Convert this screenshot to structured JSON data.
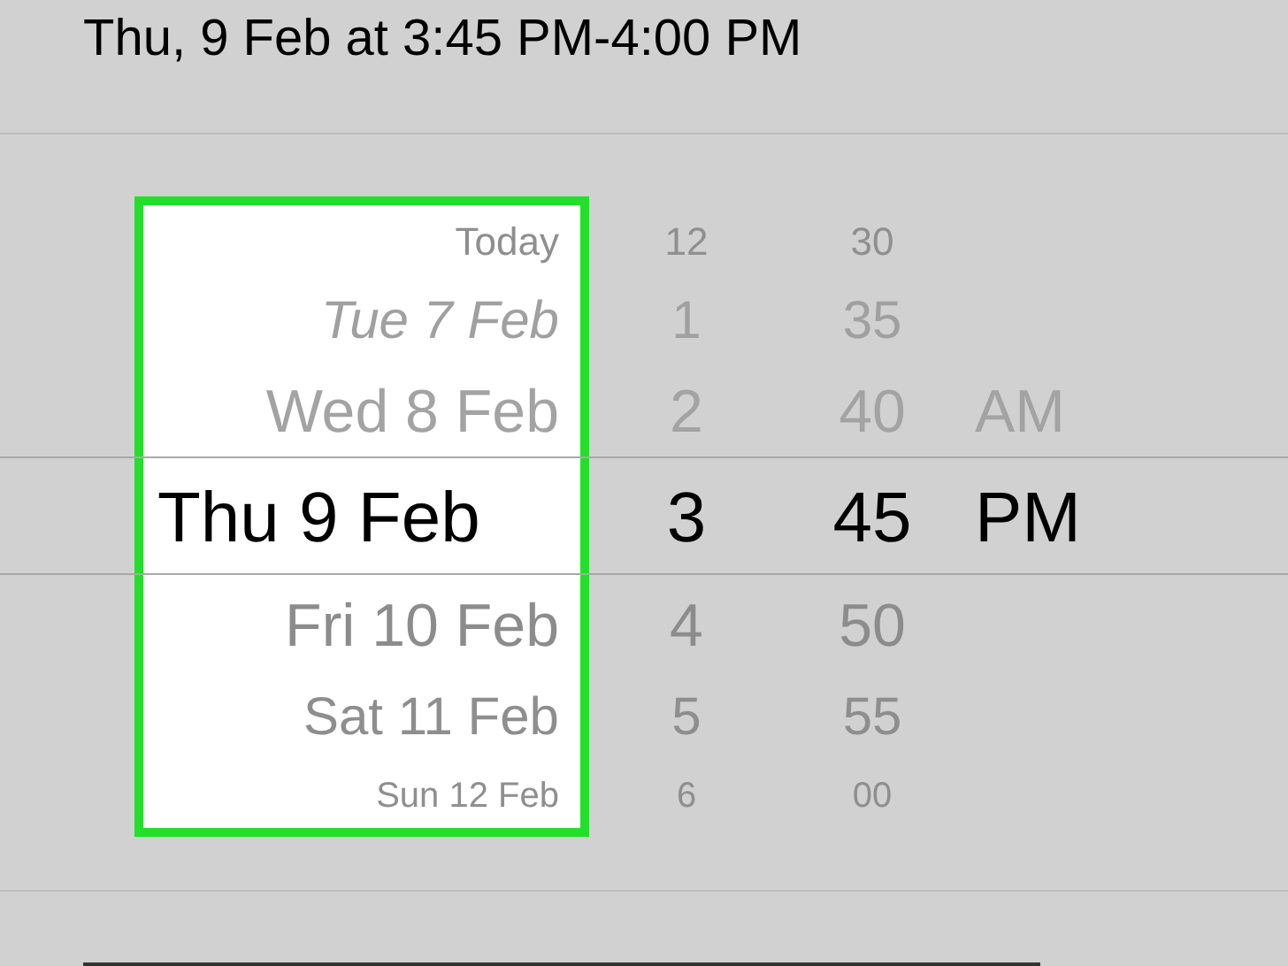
{
  "header": {
    "title": "Thu, 9 Feb at 3:45 PM-4:00 PM"
  },
  "picker": {
    "columns": [
      {
        "kind": "date",
        "highlighted": true,
        "items": [
          {
            "label": "Today",
            "selected": false
          },
          {
            "label": "Tue 7 Feb",
            "selected": false
          },
          {
            "label": "Wed 8 Feb",
            "selected": false
          },
          {
            "label": "Thu 9 Feb",
            "selected": true
          },
          {
            "label": "Fri 10 Feb",
            "selected": false
          },
          {
            "label": "Sat 11 Feb",
            "selected": false
          },
          {
            "label": "Sun 12 Feb",
            "selected": false
          }
        ]
      },
      {
        "kind": "hour",
        "highlighted": false,
        "items": [
          {
            "label": "12",
            "selected": false
          },
          {
            "label": "1",
            "selected": false
          },
          {
            "label": "2",
            "selected": false
          },
          {
            "label": "3",
            "selected": true
          },
          {
            "label": "4",
            "selected": false
          },
          {
            "label": "5",
            "selected": false
          },
          {
            "label": "6",
            "selected": false
          }
        ]
      },
      {
        "kind": "minute",
        "highlighted": false,
        "items": [
          {
            "label": "30",
            "selected": false
          },
          {
            "label": "35",
            "selected": false
          },
          {
            "label": "40",
            "selected": false
          },
          {
            "label": "45",
            "selected": true
          },
          {
            "label": "50",
            "selected": false
          },
          {
            "label": "55",
            "selected": false
          },
          {
            "label": "00",
            "selected": false
          }
        ]
      },
      {
        "kind": "period",
        "highlighted": false,
        "items": [
          {
            "label": "AM",
            "selected": false
          },
          {
            "label": "PM",
            "selected": true
          }
        ]
      }
    ]
  }
}
